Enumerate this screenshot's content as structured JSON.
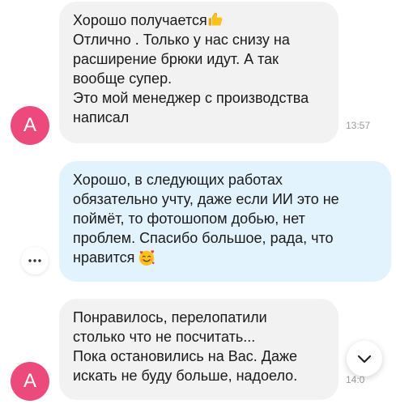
{
  "chat": {
    "messages": [
      {
        "direction": "incoming",
        "avatar_letter": "A",
        "lines": [
          "Хорошо получается",
          "Отлично . Только у нас снизу на",
          "расширение брюки идут. А так",
          "вообще супер.",
          "Это мой менеджер с производства",
          "написал"
        ],
        "emoji_after_first_line": "thumbs-up",
        "time": "13:57"
      },
      {
        "direction": "outgoing",
        "lines": [
          "Хорошо, в следующих работах",
          "обязательно учту, даже если ИИ это не",
          "поймёт, то фотошопом добью, нет",
          "проблем. Спасибо большое, рада, что",
          "нравится"
        ],
        "emoji_after_last_line": "smiling-face-with-hearts"
      },
      {
        "direction": "incoming",
        "avatar_letter": "A",
        "lines": [
          "Понравилось, перелопатили",
          "столько что не посчитать...",
          "Пока остановились на Вас. Даже",
          "искать не буду больше, надоело."
        ],
        "time": "14:0"
      }
    ],
    "controls": {
      "more_icon": "more-horizontal-icon",
      "scroll_down_icon": "chevron-down-icon"
    }
  },
  "colors": {
    "avatar": "#ec4a7c",
    "incoming_bubble": "#f2f2f2",
    "outgoing_bubble": "#e3f3fd",
    "timestamp": "#9a9a9a"
  }
}
